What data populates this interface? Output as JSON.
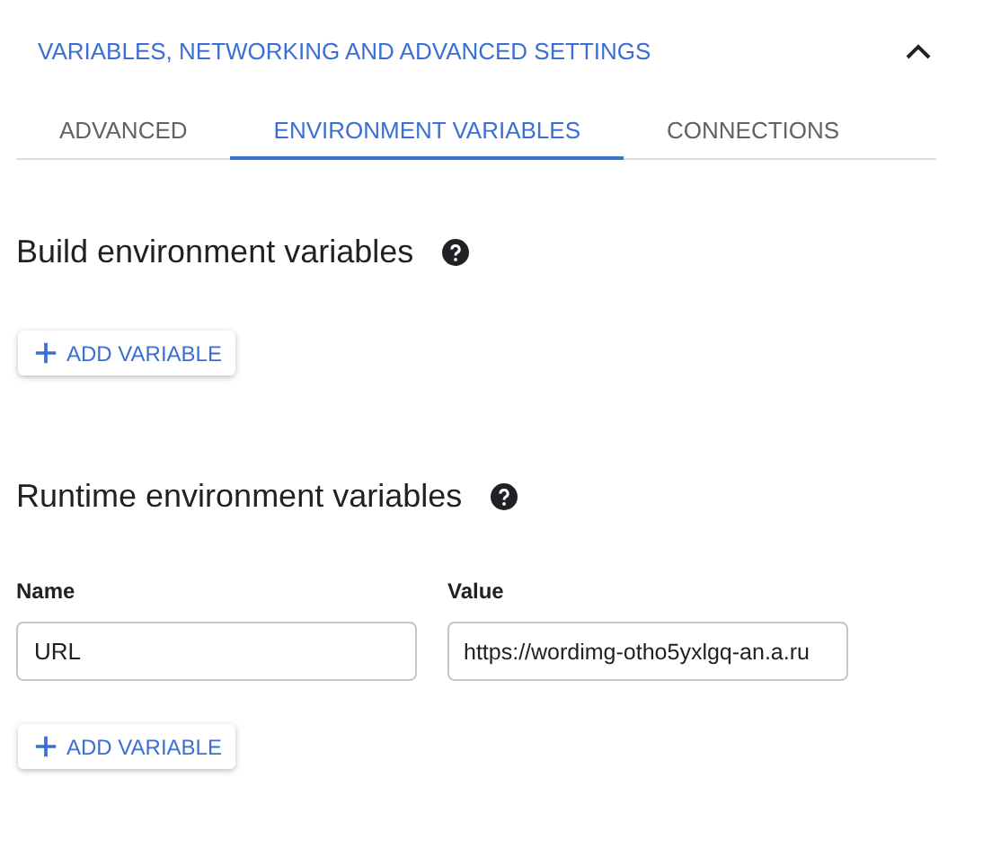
{
  "section": {
    "title": "VARIABLES, NETWORKING AND ADVANCED SETTINGS",
    "expanded": true
  },
  "tabs": [
    {
      "label": "ADVANCED",
      "selected": false
    },
    {
      "label": "ENVIRONMENT VARIABLES",
      "selected": true
    },
    {
      "label": "CONNECTIONS",
      "selected": false
    }
  ],
  "build": {
    "heading": "Build environment variables",
    "button": "ADD VARIABLE"
  },
  "runtime": {
    "heading": "Runtime environment variables",
    "name_label": "Name",
    "value_label": "Value",
    "rows": [
      {
        "name": "URL",
        "value": "https://wordimg-otho5yxlgq-an.a.ru"
      }
    ],
    "button": "ADD VARIABLE"
  }
}
